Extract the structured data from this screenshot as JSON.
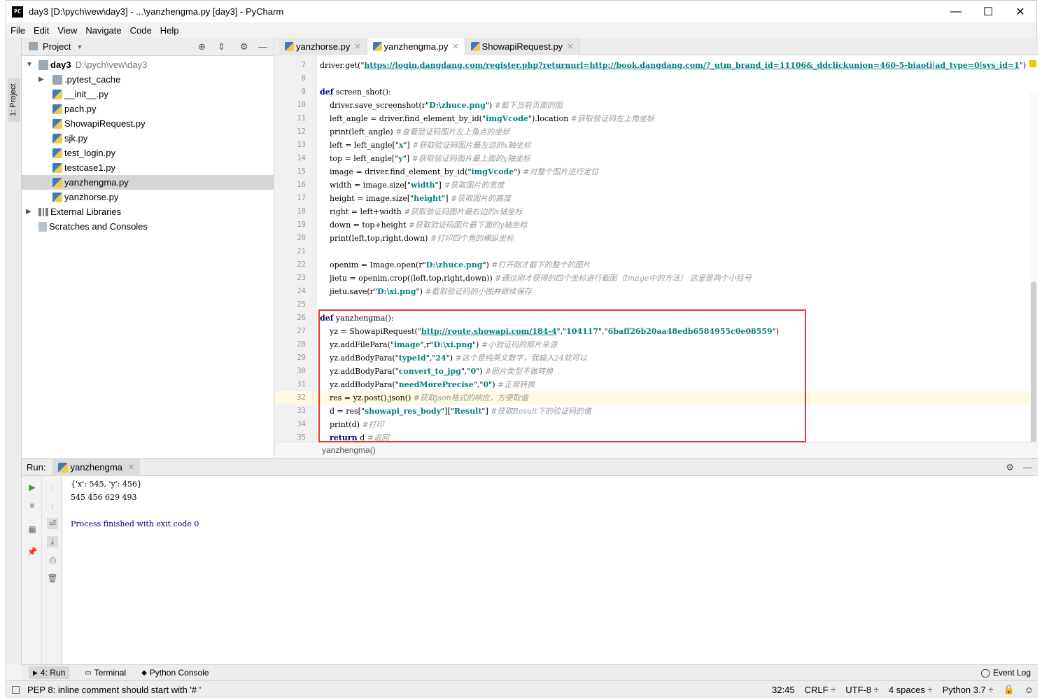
{
  "window": {
    "title": "day3 [D:\\pych\\vew\\day3] - ...\\yanzhengma.py [day3] - PyCharm",
    "minimize": "—",
    "maximize": "☐",
    "close": "✕"
  },
  "menu": [
    "File",
    "Edit",
    "View",
    "Navigate",
    "Code",
    "Help"
  ],
  "left_strip": {
    "tab_label": "1: Project"
  },
  "project": {
    "header": "Project",
    "root": {
      "name": "day3",
      "path": "D:\\pych\\vew\\day3"
    },
    "items": [
      ".pytest_cache",
      "__init__.py",
      "pach.py",
      "ShowapiRequest.py",
      "sjk.py",
      "test_login.py",
      "testcase1.py",
      "yanzhengma.py",
      "yanzhorse.py"
    ],
    "external": "External Libraries",
    "scratches": "Scratches and Consoles"
  },
  "editor": {
    "tabs": [
      "yanzhorse.py",
      "yanzhengma.py",
      "ShowapiRequest.py"
    ],
    "breadcrumb": "yanzhengma()",
    "lines": [
      {
        "n": "7",
        "html": "driver.get(\"<u class='url'>https://login.dangdang.com/register.php?returnurl=http://book.dangdang.com/?_utm_brand_id=11106&_ddclickunion=460-5-biaoti|ad_type=0|sys_id=1</u>\")"
      },
      {
        "n": "8",
        "html": ""
      },
      {
        "n": "9",
        "html": "<span class='kw'>def</span> screen_shot():"
      },
      {
        "n": "10",
        "html": "    driver.save_screenshot(r\"<span class='st'>D:\\zhuce.png</span>\") <span class='cm'>#截下当前页面的图</span>"
      },
      {
        "n": "11",
        "html": "    left_angle = driver.find_element_by_id(\"<span class='st'>imgVcode</span>\").location <span class='cm'>#获取验证码左上角坐标</span>"
      },
      {
        "n": "12",
        "html": "    print(left_angle) <span class='cm'>#查看验证码图片左上角点的坐标</span>"
      },
      {
        "n": "13",
        "html": "    left = left_angle[\"<span class='st'>x</span>\"] <span class='cm'>#获取验证码图片最左边的x轴坐标</span>"
      },
      {
        "n": "14",
        "html": "    top = left_angle[\"<span class='st'>y</span>\"] <span class='cm'>#获取验证码图片最上面的y轴坐标</span>"
      },
      {
        "n": "15",
        "html": "    image = driver.find_element_by_id(\"<span class='st'>imgVcode</span>\") <span class='cm'>#对整个图片进行定位</span>"
      },
      {
        "n": "16",
        "html": "    width = image.size[\"<span class='st'>width</span>\"] <span class='cm'>#获取图片的宽度</span>"
      },
      {
        "n": "17",
        "html": "    height = image.size[\"<span class='st'>height</span>\"] <span class='cm'>#获取图片的高度</span>"
      },
      {
        "n": "18",
        "html": "    right = left+width <span class='cm'>#获取验证码图片最右边的x轴坐标</span>"
      },
      {
        "n": "19",
        "html": "    down = top+height <span class='cm'>#获取验证码图片最下面的y轴坐标</span>"
      },
      {
        "n": "20",
        "html": "    print(left,top,right,down) <span class='cm'>#打印四个角的横纵坐标</span>"
      },
      {
        "n": "21",
        "html": ""
      },
      {
        "n": "22",
        "html": "    openim = Image.open(r\"<span class='st'>D:\\zhuce.png</span>\") <span class='cm'>#打开刚才截下的整个的图片</span>"
      },
      {
        "n": "23",
        "html": "    jietu = openim.crop((left,top,right,down)) <span class='cm'>#通过刚才获得的四个坐标进行截图（Image中的方法） 这里是两个小括号</span>"
      },
      {
        "n": "24",
        "html": "    jietu.save(r\"<span class='st'>D:\\xi.png</span>\") <span class='cm'>#截取验证码的小图并继续保存</span>"
      },
      {
        "n": "25",
        "html": ""
      },
      {
        "n": "26",
        "html": "<span class='kw'>def</span> yanzhengma():"
      },
      {
        "n": "27",
        "html": "    yz = ShowapiRequest(\"<u class='url'>http://route.showapi.com/184-4</u>\",\"<span class='st'>104117</span>\",\"<span class='st'>6baff26b20aa48edb6584955c0e08559</span>\")"
      },
      {
        "n": "28",
        "html": "    yz.addFilePara(\"<span class='st'>image</span>\",r\"<span class='st'>D:\\xi.png</span>\") <span class='cm'>#小验证码的照片来源</span>"
      },
      {
        "n": "29",
        "html": "    yz.addBodyPara(\"<span class='st'>typeId</span>\",\"<span class='st'>24</span>\") <span class='cm'>#这个是纯英文数字，我输入24就可以</span>"
      },
      {
        "n": "30",
        "html": "    yz.addBodyPara(\"<span class='st'>convert_to_jpg</span>\",\"<span class='st'>0</span>\") <span class='cm'>#照片类型不做转换</span>"
      },
      {
        "n": "31",
        "html": "    yz.addBodyPara(\"<span class='st'>needMorePrecise</span>\",\"<span class='st'>0</span>\") <span class='cm'>#正常转换</span>"
      },
      {
        "n": "32",
        "html": "    res = yz.post().json() <span class='cm'>#获取json格式的响应，方便取值</span>"
      },
      {
        "n": "33",
        "html": "    d = res[\"<span class='st'>showapi_res_body</span>\"][\"<span class='st'>Result</span>\"] <span class='cm'>#获取Result下的验证码的值</span>"
      },
      {
        "n": "34",
        "html": "    print(d) <span class='cm'>#打印</span>"
      },
      {
        "n": "35",
        "html": "    <span class='kw'>return</span> d <span class='cm'>#返回</span>"
      }
    ]
  },
  "run": {
    "label": "Run:",
    "tab": "yanzhengma",
    "output": [
      "{'x': 545, 'y': 456}",
      "545 456 629 493",
      "",
      "Process finished with exit code 0"
    ]
  },
  "bottom_tabs": [
    "4: Run",
    "Terminal",
    "Python Console"
  ],
  "event_log": "Event Log",
  "status": {
    "message": "PEP 8: inline comment should start with '# '",
    "position": "32:45",
    "line_sep": "CRLF ÷",
    "encoding": "UTF-8 ÷",
    "indent": "4 spaces ÷",
    "interpreter": "Python 3.7 ÷"
  }
}
